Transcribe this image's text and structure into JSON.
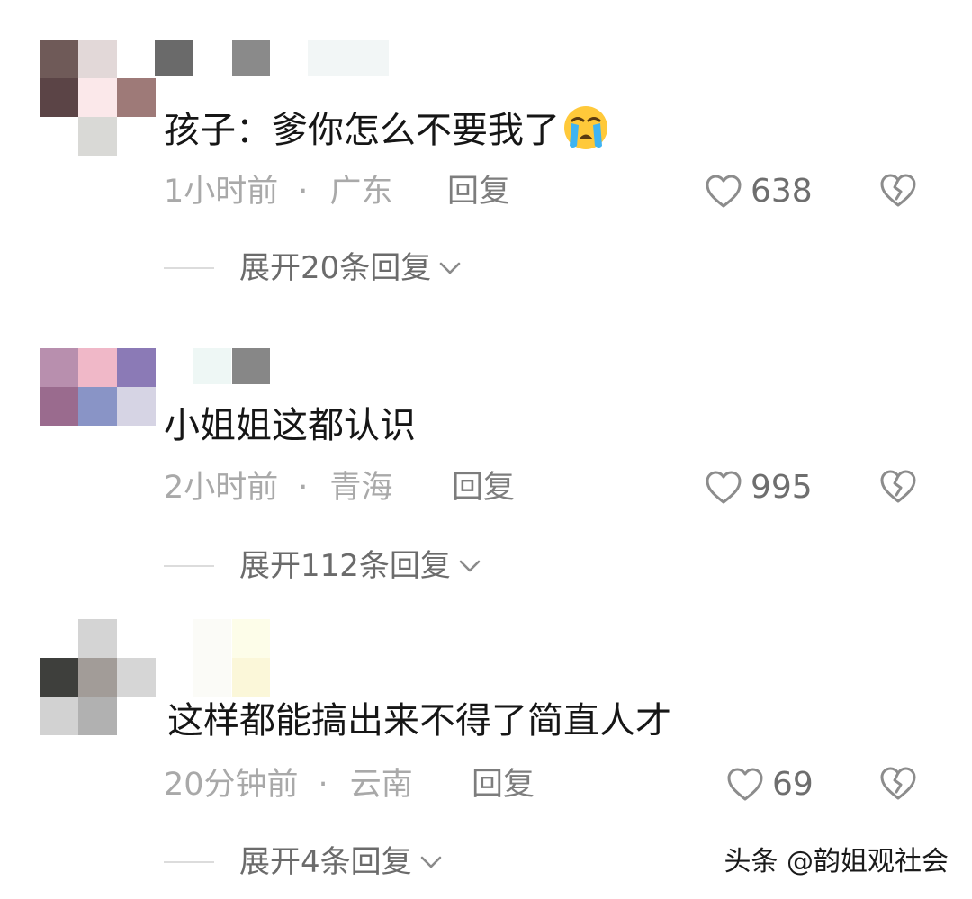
{
  "comments": [
    {
      "text": "孩子：爹你怎么不要我了",
      "emoji": "loudly-crying-face",
      "time": "1小时前",
      "separator": "·",
      "location": "广东",
      "reply_label": "回复",
      "likes": "638",
      "expand_label": "展开20条回复"
    },
    {
      "text": "小姐姐这都认识",
      "time": "2小时前",
      "separator": "·",
      "location": "青海",
      "reply_label": "回复",
      "likes": "995",
      "expand_label": "展开112条回复"
    },
    {
      "text": "这样都能搞出来不得了简直人才",
      "time": "20分钟前",
      "separator": "·",
      "location": "云南",
      "reply_label": "回复",
      "likes": "69",
      "expand_label": "展开4条回复"
    }
  ],
  "icons": {
    "like": "heart-outline-icon",
    "dislike": "broken-heart-icon",
    "expand": "chevron-down-icon"
  },
  "colors": {
    "text": "#161616",
    "meta": "#a9a9a9",
    "reply": "#7d7d7d",
    "icon": "#8c8c8c"
  },
  "watermark": "头条 @韵姐观社会"
}
